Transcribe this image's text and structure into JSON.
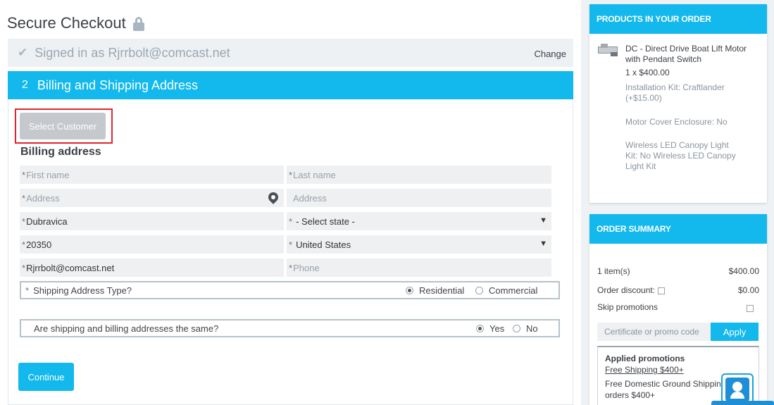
{
  "page": {
    "title": "Secure Checkout"
  },
  "signed_in": {
    "text": "Signed in as Rjrrbolt@comcast.net",
    "change_label": "Change"
  },
  "step": {
    "number": "2",
    "title": "Billing and Shipping Address"
  },
  "select_customer_label": "Select Customer",
  "billing": {
    "label": "Billing address",
    "required_mark": "*",
    "first_name_placeholder": "First name",
    "last_name_placeholder": "Last name",
    "address_placeholder": "Address",
    "address2_placeholder": "Address",
    "city_value": "Dubravica",
    "state_value": "- Select state -",
    "zip_value": "20350",
    "country_value": "United States",
    "email_value": "Rjrrbolt@comcast.net",
    "phone_placeholder": "Phone"
  },
  "shipping_type": {
    "question": "Shipping Address Type?",
    "options": [
      {
        "label": "Residential",
        "checked": true
      },
      {
        "label": "Commercial",
        "checked": false
      }
    ]
  },
  "same_address": {
    "question": "Are shipping and billing addresses the same?",
    "options": [
      {
        "label": "Yes",
        "checked": true
      },
      {
        "label": "No",
        "checked": false
      }
    ]
  },
  "continue_label": "Continue",
  "products": {
    "header": "PRODUCTS IN YOUR ORDER",
    "item": {
      "title": "DC - Direct Drive Boat Lift Motor with Pendant Switch",
      "qty_price": "1 x $400.00",
      "option1": "Installation Kit: Craftlander (+$15.00)",
      "option2": "Motor Cover Enclosure: No",
      "option3": "Wireless LED Canopy Light Kit: No Wireless LED Canopy Light Kit"
    }
  },
  "summary": {
    "header": "ORDER SUMMARY",
    "items_label": "1 item(s)",
    "items_value": "$400.00",
    "discount_label": "Order discount:",
    "discount_value": "$0.00",
    "skip_label": "Skip promotions",
    "promo_placeholder": "Certificate or promo code",
    "apply_label": "Apply",
    "applied_title": "Applied promotions",
    "applied_link": "Free Shipping $400+",
    "applied_desc": "Free Domestic Ground Shipping orders $400+"
  },
  "colors": {
    "accent": "#13b8ec",
    "highlight": "#e0262b"
  }
}
